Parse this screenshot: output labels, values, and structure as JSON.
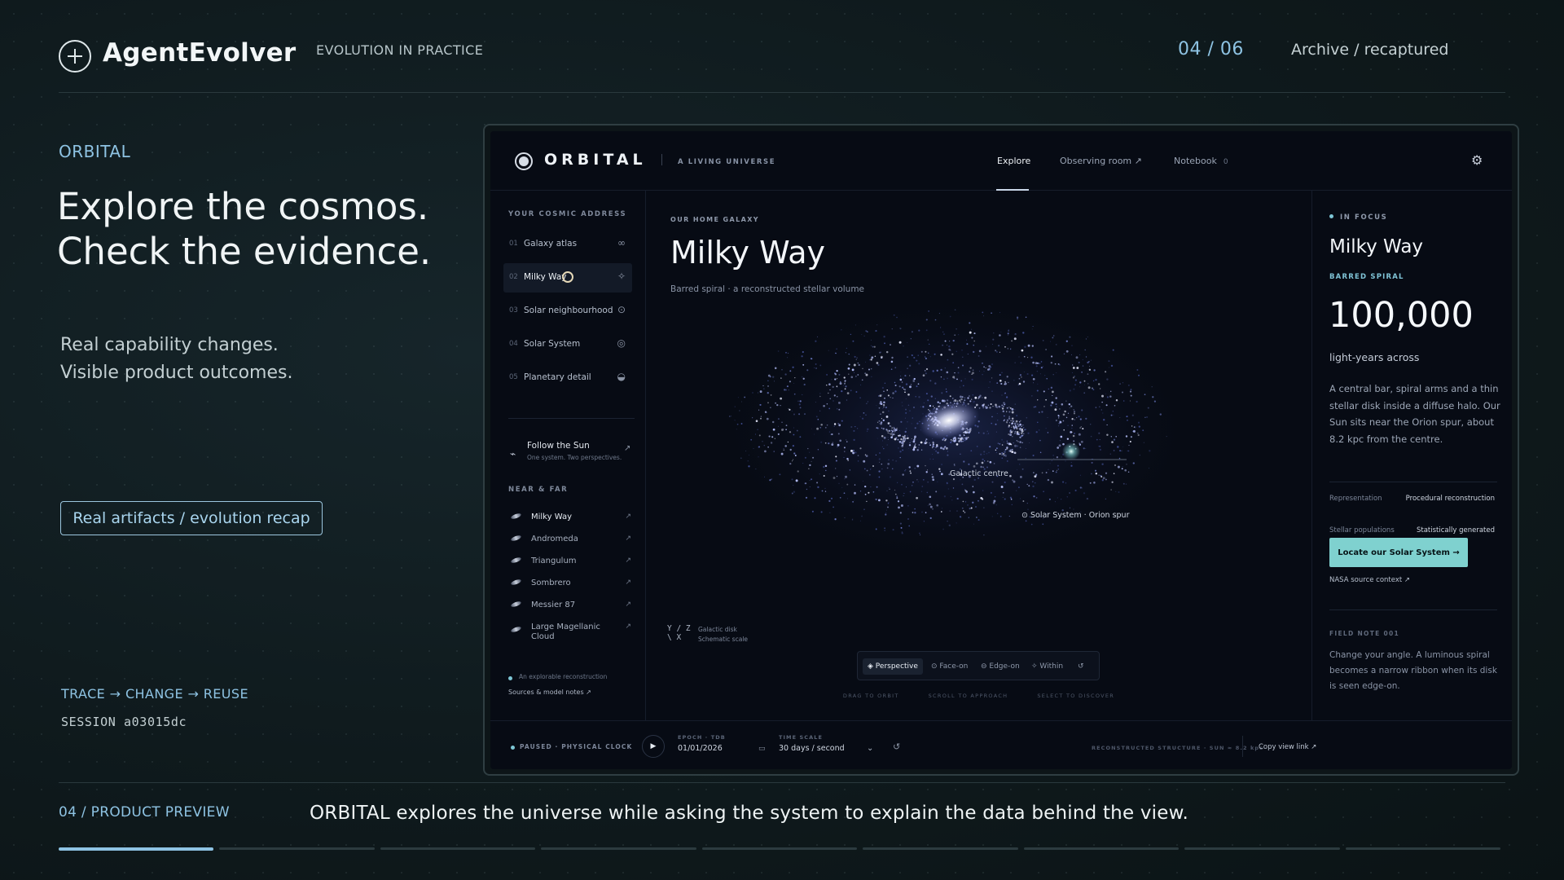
{
  "header": {
    "brand": "AgentEvolver",
    "tagline": "EVOLUTION IN PRACTICE",
    "counter": "04 / 06",
    "archive": "Archive / recaptured"
  },
  "intro": {
    "kicker": "ORBITAL",
    "headline_1": "Explore the cosmos.",
    "headline_2": "Check the evidence.",
    "sub_1": "Real capability changes.",
    "sub_2": "Visible product outcomes.",
    "pill": "Real artifacts / evolution recap",
    "trace": "TRACE → CHANGE → REUSE",
    "session": "SESSION  a03015dc"
  },
  "app": {
    "name": "ORBITAL",
    "tagline": "A LIVING UNIVERSE",
    "tabs": {
      "explore": "Explore",
      "observe": "Observing room ↗",
      "notebook": "Notebook",
      "notebook_count": "0"
    },
    "sidebar": {
      "address_head": "YOUR COSMIC ADDRESS",
      "address_items": [
        {
          "num": "01",
          "label": "Galaxy atlas",
          "icon": "∞"
        },
        {
          "num": "02",
          "label": "Milky Way",
          "icon": "✧"
        },
        {
          "num": "03",
          "label": "Solar neighbourhood",
          "icon": "⊙"
        },
        {
          "num": "04",
          "label": "Solar System",
          "icon": "◎"
        },
        {
          "num": "05",
          "label": "Planetary detail",
          "icon": "◒"
        }
      ],
      "follow_title": "Follow the Sun",
      "follow_sub": "One system. Two perspectives.",
      "near_head": "NEAR & FAR",
      "near_items": [
        "Milky Way",
        "Andromeda",
        "Triangulum",
        "Sombrero",
        "Messier 87",
        "Large Magellanic Cloud"
      ],
      "recon_note": "An explorable reconstruction",
      "sources": "Sources & model notes ↗"
    },
    "main": {
      "kicker": "OUR HOME GALAXY",
      "title": "Milky Way",
      "subtitle": "Barred spiral · a reconstructed stellar volume",
      "centre_label": "Galactic centre",
      "sol_label": "⊙ Solar System · Orion spur",
      "axis_glyph_1": "Y / Z",
      "axis_glyph_2": "\\ X",
      "axis_note_1": "Galactic disk",
      "axis_note_2": "Schematic scale",
      "views": [
        "Perspective",
        "Face-on",
        "Edge-on",
        "Within"
      ],
      "hints": [
        "DRAG TO ORBIT",
        "SCROLL TO APPROACH",
        "SELECT TO DISCOVER"
      ]
    },
    "focus": {
      "kicker": "IN FOCUS",
      "title": "Milky Way",
      "type": "BARRED SPIRAL",
      "big": "100,000",
      "unit": "light-years across",
      "desc": "A central bar, spiral arms and a thin stellar disk inside a diffuse halo. Our Sun sits near the Orion spur, about 8.2 kpc from the centre.",
      "rep_key": "Representation",
      "rep_val": "Procedural reconstruction",
      "pop_key": "Stellar populations",
      "pop_val": "Statistically generated",
      "locate": "Locate our Solar System →",
      "nasa": "NASA source context ↗",
      "fn_kicker": "FIELD NOTE 001",
      "fn_text": "Change your angle. A luminous spiral becomes a narrow ribbon when its disk is seen edge-on."
    },
    "bottom": {
      "paused": "PAUSED · PHYSICAL CLOCK",
      "epoch_label": "EPOCH · TDB",
      "epoch": "01/01/2026",
      "scale_label": "TIME SCALE",
      "scale": "30 days / second",
      "structure": "RECONSTRUCTED STRUCTURE   ·   SUN ≈ 8.2 kpc",
      "copy": "Copy view link ↗"
    }
  },
  "footer": {
    "label": "04 / PRODUCT PREVIEW",
    "caption": "ORBITAL explores the universe while asking the system to explain the data behind the view.",
    "progress_active": 1,
    "progress_total": 9
  }
}
